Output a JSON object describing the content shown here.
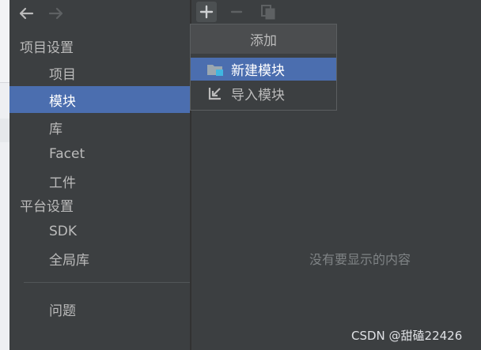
{
  "sidebar": {
    "groups": [
      {
        "header": "项目设置",
        "items": [
          "项目",
          "模块",
          "库",
          "Facet",
          "工件"
        ]
      },
      {
        "header": "平台设置",
        "items": [
          "SDK",
          "全局库"
        ]
      }
    ],
    "selected_item": "模块",
    "problems_label": "问题"
  },
  "popup": {
    "title": "添加",
    "items": [
      "新建模块",
      "导入模块"
    ],
    "selected": "新建模块"
  },
  "main": {
    "empty_text": "没有要显示的内容"
  },
  "watermark": "CSDN @甜磕22426",
  "colors": {
    "background": "#3c3f41",
    "selection": "#4b6eaf",
    "text": "#bbbbbb",
    "muted_text": "#7f8385"
  },
  "icons": {
    "back": "arrow-left-icon",
    "forward": "arrow-right-icon",
    "add": "plus-icon",
    "remove": "minus-icon",
    "copy": "copy-icon",
    "new_module": "folder-module-icon",
    "import_module": "import-arrow-icon"
  }
}
